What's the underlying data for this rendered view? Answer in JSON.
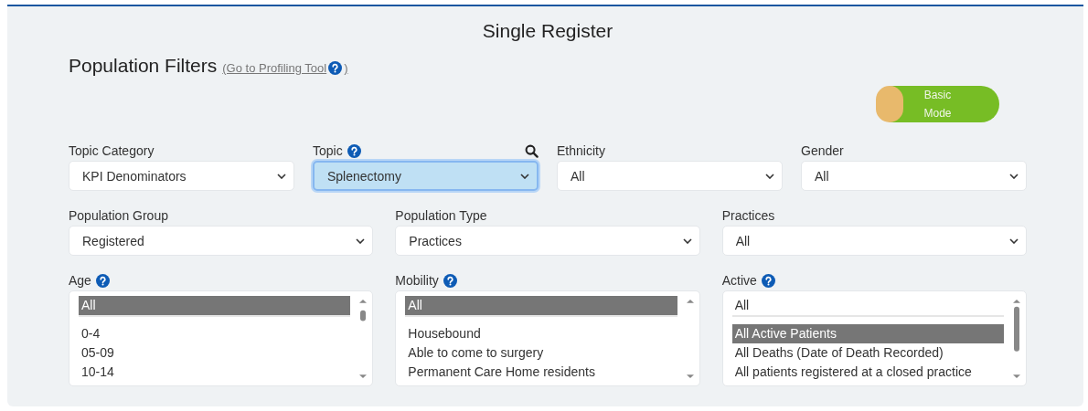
{
  "title": "Single Register",
  "filters_heading": "Population Filters",
  "profiling_link": "(Go to Profiling Tool ",
  "profiling_link_close": ")",
  "mode_toggle": {
    "label_line1": "Basic",
    "label_line2": "Mode",
    "on": false
  },
  "row1": [
    {
      "label": "Topic Category",
      "help": false,
      "search": false,
      "value": "KPI Denominators",
      "focused": false
    },
    {
      "label": "Topic",
      "help": true,
      "search": true,
      "value": "Splenectomy",
      "focused": true
    },
    {
      "label": "Ethnicity",
      "help": false,
      "search": false,
      "value": "All",
      "focused": false
    },
    {
      "label": "Gender",
      "help": false,
      "search": false,
      "value": "All",
      "focused": false
    }
  ],
  "row2": [
    {
      "label": "Population Group",
      "help": false,
      "search": false,
      "value": "Registered",
      "focused": false
    },
    {
      "label": "Population Type",
      "help": false,
      "search": false,
      "value": "Practices",
      "focused": false
    },
    {
      "label": "Practices",
      "help": false,
      "search": false,
      "value": "All",
      "focused": false
    }
  ],
  "lists": [
    {
      "label": "Age",
      "help": true,
      "options": [
        {
          "text": "All",
          "selected": true
        },
        {
          "text": "0-4",
          "selected": false
        },
        {
          "text": "05-09",
          "selected": false
        },
        {
          "text": "10-14",
          "selected": false
        }
      ]
    },
    {
      "label": "Mobility",
      "help": true,
      "options": [
        {
          "text": "All",
          "selected": true
        },
        {
          "text": "Housebound",
          "selected": false
        },
        {
          "text": "Able to come to surgery",
          "selected": false
        },
        {
          "text": "Permanent Care Home residents",
          "selected": false
        }
      ]
    },
    {
      "label": "Active",
      "help": true,
      "options": [
        {
          "text": "All",
          "selected": false
        },
        {
          "text": "All Active Patients",
          "selected": true
        },
        {
          "text": "All Deaths (Date of Death Recorded)",
          "selected": false
        },
        {
          "text": "All patients registered at a closed practice",
          "selected": false
        }
      ]
    }
  ]
}
